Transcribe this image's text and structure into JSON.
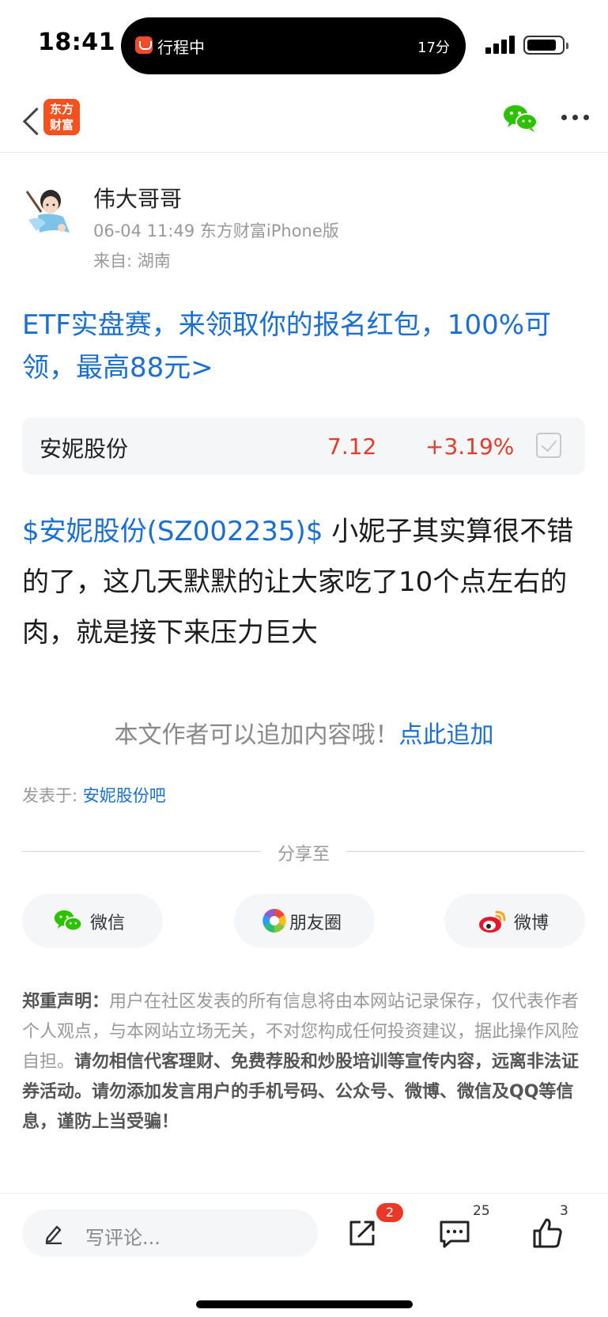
{
  "status_bar": {
    "time": "18:41",
    "activity_label": "行程中",
    "activity_eta": "17分"
  },
  "nav": {
    "logo_line1": "东方",
    "logo_line2": "财富",
    "brand_color": "#f4511e"
  },
  "author": {
    "name": "伟大哥哥",
    "meta": "06-04 11:49 东方财富iPhone版",
    "location": "来自: 湖南"
  },
  "promo": {
    "text": "ETF实盘赛，来领取你的报名红包，100%可领，最高88元>"
  },
  "stock_card": {
    "name": "安妮股份",
    "price": "7.12",
    "change": "+3.19%"
  },
  "post": {
    "stock_tag": "$安妮股份(SZ002235)$",
    "text": " 小妮子其实算很不错的了，这几天默默的让大家吃了10个点左右的肉，就是接下来压力巨大"
  },
  "append": {
    "hint": "本文作者可以追加内容哦！",
    "link": "点此追加"
  },
  "posted_in": {
    "label": "发表于: ",
    "forum": "安妮股份吧"
  },
  "share": {
    "title": "分享至",
    "wechat": "微信",
    "moments": "朋友圈",
    "weibo": "微博"
  },
  "disclaimer": {
    "title": "郑重声明：",
    "body": "用户在社区发表的所有信息将由本网站记录保存，仅代表作者个人观点，与本网站立场无关，不对您构成任何投资建议，据此操作风险自担。",
    "warning": "请勿相信代客理财、免费荐股和炒股培训等宣传内容，远离非法证券活动。请勿添加发言用户的手机号码、公众号、微博、微信及QQ等信息，谨防上当受骗！"
  },
  "bottom_bar": {
    "comment_placeholder": "写评论...",
    "share_badge": "2",
    "comment_count": "25",
    "like_count": "3"
  },
  "colors": {
    "link_blue": "#1a6fd0",
    "up_red": "#e4392b"
  }
}
